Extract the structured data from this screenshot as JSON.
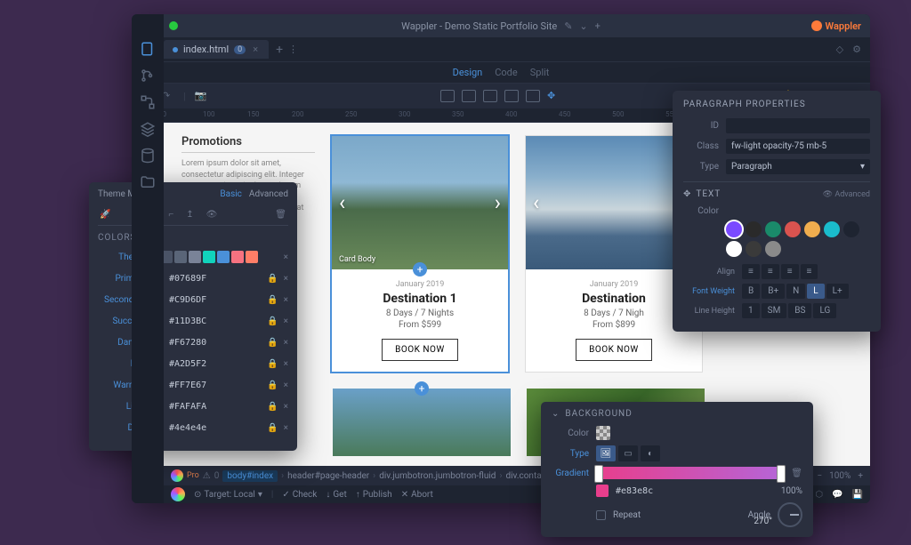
{
  "titlebar": {
    "title": "Wappler - Demo Static Portfolio Site",
    "brand": "Wappler"
  },
  "tab": {
    "name": "index.html",
    "badge": "0"
  },
  "views": {
    "design": "Design",
    "code": "Code",
    "split": "Split"
  },
  "canvas": {
    "promo": {
      "heading": "Promotions",
      "text": "Lorem ipsum dolor sit amet, consectetur adipiscing elit. Integer posuere erat a ante. Lorem ipsum dolor sit amet, consectetur adipiscing elit. Aliquam consequat condimentum."
    },
    "card1": {
      "label": "Card Body",
      "date": "January 2019",
      "title": "Destination 1",
      "sub": "8 Days / 7 Nights",
      "price": "From $599",
      "btn": "BOOK NOW"
    },
    "card2": {
      "date": "January 2019",
      "title": "Destination",
      "sub": "8 Days / 7 Nigh",
      "price": "From $899",
      "btn": "BOOK NOW"
    }
  },
  "breadcrumb": {
    "a": "body#index",
    "b": "header#page-header",
    "c": "div.jumbotron.jumbotron-fluid",
    "d": "div.container.text-center"
  },
  "statusbar": {
    "zoom": "100%"
  },
  "bottombar": {
    "target": "Target: Local",
    "check": "Check",
    "get": "Get",
    "publish": "Publish",
    "abort": "Abort"
  },
  "theme": {
    "title": "Theme Manager",
    "basic": "Basic",
    "advanced": "Advanced",
    "section": "COLORS",
    "rows": [
      {
        "label": "Theme"
      },
      {
        "label": "Primary",
        "hex": "#07689F"
      },
      {
        "label": "Secondary",
        "hex": "#C9D6DF"
      },
      {
        "label": "Success",
        "hex": "#11D3BC"
      },
      {
        "label": "Danger",
        "hex": "#F67280"
      },
      {
        "label": "Info",
        "hex": "#A2D5F2"
      },
      {
        "label": "Warning",
        "hex": "#FF7E67"
      },
      {
        "label": "Light",
        "hex": "#FAFAFA"
      },
      {
        "label": "Dark",
        "hex": "#4e4e4e"
      }
    ],
    "swatches": [
      "#4a5366",
      "#5a6578",
      "#7a8398",
      "#11D3BC",
      "#4a90d9",
      "#F67280",
      "#FF7E67"
    ]
  },
  "props": {
    "title": "PARAGRAPH PROPERTIES",
    "id": "ID",
    "class_lbl": "Class",
    "class_val": "fw-light opacity-75 mb-5",
    "type_lbl": "Type",
    "type_val": "Paragraph",
    "text": "TEXT",
    "advanced": "Advanced",
    "color": "Color",
    "align": "Align",
    "fw": "Font Weight",
    "fw_opts": [
      "B",
      "B+",
      "N",
      "L",
      "L+"
    ],
    "lh": "Line Height",
    "lh_opts": [
      "1",
      "SM",
      "BS",
      "LG"
    ],
    "dots": [
      "#7a4aff",
      "#2a2a2a",
      "#1a8a6a",
      "#d9534f",
      "#f0ad4e",
      "#1abccc",
      "#1e2431",
      "#ffffff",
      "#3a3a3a",
      "#8a8a8a"
    ]
  },
  "bg": {
    "title": "BACKGROUND",
    "color": "Color",
    "type": "Type",
    "gradient": "Gradient",
    "hex": "#e83e8c",
    "pct": "100%",
    "repeat": "Repeat",
    "angle": "Angle",
    "deg": "270°"
  }
}
